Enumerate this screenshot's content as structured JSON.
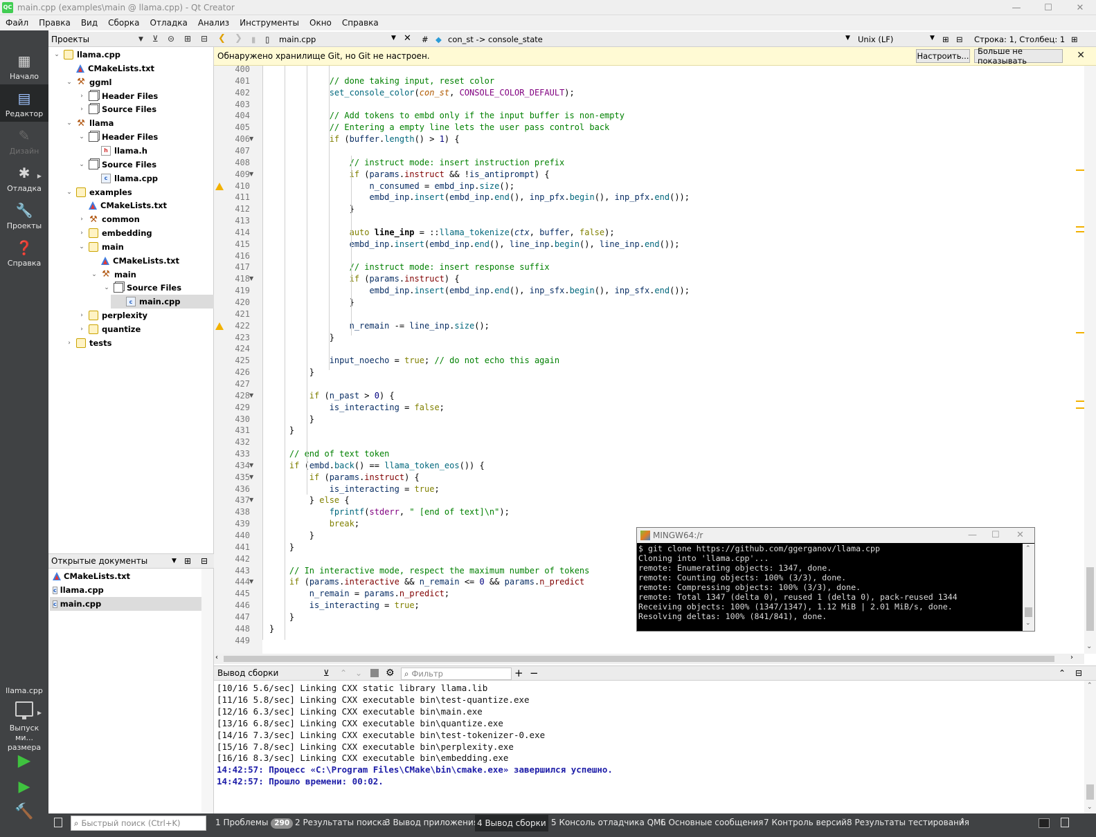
{
  "window": {
    "title": "main.cpp (examples\\main @ llama.cpp) - Qt Creator",
    "logo": "QC"
  },
  "menu": [
    "Файл",
    "Правка",
    "Вид",
    "Сборка",
    "Отладка",
    "Анализ",
    "Инструменты",
    "Окно",
    "Справка"
  ],
  "modes": [
    {
      "label": "Начало",
      "icon": "grid-icon"
    },
    {
      "label": "Редактор",
      "icon": "editor-icon"
    },
    {
      "label": "Дизайн",
      "icon": "design-icon"
    },
    {
      "label": "Отладка",
      "icon": "bug-icon"
    },
    {
      "label": "Проекты",
      "icon": "wrench-icon"
    },
    {
      "label": "Справка",
      "icon": "help-icon"
    }
  ],
  "kit": {
    "project": "llama.cpp",
    "config": "Выпуск ми... размера"
  },
  "projects_panel": {
    "title": "Проекты",
    "tree": [
      {
        "label": "llama.cpp",
        "depth": 0,
        "icon": "project",
        "expanded": true
      },
      {
        "label": "CMakeLists.txt",
        "depth": 1,
        "icon": "cmake"
      },
      {
        "label": "ggml",
        "depth": 1,
        "icon": "hammer",
        "expanded": true
      },
      {
        "label": "Header Files",
        "depth": 2,
        "icon": "folder",
        "expanded": false
      },
      {
        "label": "Source Files",
        "depth": 2,
        "icon": "folder",
        "expanded": false
      },
      {
        "label": "llama",
        "depth": 1,
        "icon": "hammer",
        "expanded": true
      },
      {
        "label": "Header Files",
        "depth": 2,
        "icon": "folder",
        "expanded": true
      },
      {
        "label": "llama.h",
        "depth": 3,
        "icon": "h"
      },
      {
        "label": "Source Files",
        "depth": 2,
        "icon": "folder",
        "expanded": true
      },
      {
        "label": "llama.cpp",
        "depth": 3,
        "icon": "cpp"
      },
      {
        "label": "examples",
        "depth": 1,
        "icon": "project",
        "expanded": true
      },
      {
        "label": "CMakeLists.txt",
        "depth": 2,
        "icon": "cmake"
      },
      {
        "label": "common",
        "depth": 2,
        "icon": "hammer",
        "expanded": false
      },
      {
        "label": "embedding",
        "depth": 2,
        "icon": "project",
        "expanded": false
      },
      {
        "label": "main",
        "depth": 2,
        "icon": "project",
        "expanded": true
      },
      {
        "label": "CMakeLists.txt",
        "depth": 3,
        "icon": "cmake"
      },
      {
        "label": "main",
        "depth": 3,
        "icon": "hammer",
        "expanded": true
      },
      {
        "label": "Source Files",
        "depth": 4,
        "icon": "folder",
        "expanded": true
      },
      {
        "label": "main.cpp",
        "depth": 5,
        "icon": "cpp",
        "selected": true
      },
      {
        "label": "perplexity",
        "depth": 2,
        "icon": "project",
        "expanded": false
      },
      {
        "label": "quantize",
        "depth": 2,
        "icon": "project",
        "expanded": false
      },
      {
        "label": "tests",
        "depth": 1,
        "icon": "project",
        "expanded": false
      }
    ]
  },
  "open_docs": {
    "title": "Открытые документы",
    "items": [
      {
        "label": "CMakeLists.txt",
        "icon": "cmake"
      },
      {
        "label": "llama.cpp",
        "icon": "cpp"
      },
      {
        "label": "main.cpp",
        "icon": "cpp",
        "selected": true
      }
    ]
  },
  "editor_toolbar": {
    "file": "main.cpp",
    "hash": "#",
    "symbol": "con_st -> console_state",
    "line_ending": "Unix (LF)",
    "position": "Строка: 1, Столбец: 1"
  },
  "git_bar": {
    "message": "Обнаружено хранилище Git, но Git не настроен.",
    "configure": "Настроить...",
    "dont_show": "Больше не показывать"
  },
  "code": {
    "lines": [
      {
        "n": "400",
        "html": ""
      },
      {
        "n": "401",
        "html": "            <span class='c-com'>// done taking input, reset color</span>"
      },
      {
        "n": "402",
        "html": "            <span class='c-fn'>set_console_color</span>(<span class='c-par'>con_st</span>, <span class='c-mac'>CONSOLE_COLOR_DEFAULT</span>);"
      },
      {
        "n": "403",
        "html": ""
      },
      {
        "n": "404",
        "html": "            <span class='c-com'>// Add tokens to embd only if the input buffer is non-empty</span>"
      },
      {
        "n": "405",
        "html": "            <span class='c-com'>// Entering a empty line lets the user pass control back</span>"
      },
      {
        "n": "406",
        "html": "            <span class='c-kw'>if</span> (<span class='c-var'>buffer</span>.<span class='c-fn'>length</span>() &gt; <span class='c-num'>1</span>) {",
        "fold": true
      },
      {
        "n": "407",
        "html": ""
      },
      {
        "n": "408",
        "html": "                <span class='c-com'>// instruct mode: insert instruction prefix</span>"
      },
      {
        "n": "409",
        "html": "                <span class='c-kw'>if</span> (<span class='c-var'>params</span>.<span class='c-mem'>instruct</span> &amp;&amp; !<span class='c-var'>is_antiprompt</span>) {",
        "fold": true
      },
      {
        "n": "410",
        "html": "                    <span class='c-var'>n_consumed</span> = <span class='c-var'>embd_inp</span>.<span class='c-fn'>size</span>();",
        "warn": true
      },
      {
        "n": "411",
        "html": "                    <span class='c-var'>embd_inp</span>.<span class='c-fn'>insert</span>(<span class='c-var'>embd_inp</span>.<span class='c-fn'>end</span>(), <span class='c-var'>inp_pfx</span>.<span class='c-fn'>begin</span>(), <span class='c-var'>inp_pfx</span>.<span class='c-fn'>end</span>());"
      },
      {
        "n": "412",
        "html": "                }"
      },
      {
        "n": "413",
        "html": ""
      },
      {
        "n": "414",
        "html": "                <span class='c-kw'>auto</span> <b>line_inp</b> = ::<span class='c-fn'>llama_tokenize</span>(<span class='c-var'><i>ctx</i></span>, <span class='c-var'>buffer</span>, <span class='c-kw'>false</span>);"
      },
      {
        "n": "415",
        "html": "                <span class='c-var'>embd_inp</span>.<span class='c-fn'>insert</span>(<span class='c-var'>embd_inp</span>.<span class='c-fn'>end</span>(), <span class='c-var'>line_inp</span>.<span class='c-fn'>begin</span>(), <span class='c-var'>line_inp</span>.<span class='c-fn'>end</span>());"
      },
      {
        "n": "416",
        "html": ""
      },
      {
        "n": "417",
        "html": "                <span class='c-com'>// instruct mode: insert response suffix</span>"
      },
      {
        "n": "418",
        "html": "                <span class='c-kw'>if</span> (<span class='c-var'>params</span>.<span class='c-mem'>instruct</span>) {",
        "fold": true
      },
      {
        "n": "419",
        "html": "                    <span class='c-var'>embd_inp</span>.<span class='c-fn'>insert</span>(<span class='c-var'>embd_inp</span>.<span class='c-fn'>end</span>(), <span class='c-var'>inp_sfx</span>.<span class='c-fn'>begin</span>(), <span class='c-var'>inp_sfx</span>.<span class='c-fn'>end</span>());"
      },
      {
        "n": "420",
        "html": "                }"
      },
      {
        "n": "421",
        "html": ""
      },
      {
        "n": "422",
        "html": "                <span class='c-var'>n_remain</span> -= <span class='c-var'>line_inp</span>.<span class='c-fn'>size</span>();",
        "warn": true
      },
      {
        "n": "423",
        "html": "            }"
      },
      {
        "n": "424",
        "html": ""
      },
      {
        "n": "425",
        "html": "            <span class='c-var'>input_noecho</span> = <span class='c-kw'>true</span>; <span class='c-com'>// do not echo this again</span>"
      },
      {
        "n": "426",
        "html": "        }"
      },
      {
        "n": "427",
        "html": ""
      },
      {
        "n": "428",
        "html": "        <span class='c-kw'>if</span> (<span class='c-var'>n_past</span> &gt; <span class='c-num'>0</span>) {",
        "fold": true
      },
      {
        "n": "429",
        "html": "            <span class='c-var'>is_interacting</span> = <span class='c-kw'>false</span>;"
      },
      {
        "n": "430",
        "html": "        }"
      },
      {
        "n": "431",
        "html": "    }"
      },
      {
        "n": "432",
        "html": ""
      },
      {
        "n": "433",
        "html": "    <span class='c-com'>// end of text token</span>"
      },
      {
        "n": "434",
        "html": "    <span class='c-kw'>if</span> (<span class='c-var'>embd</span>.<span class='c-fn'>back</span>() == <span class='c-fn'>llama_token_eos</span>()) {",
        "fold": true
      },
      {
        "n": "435",
        "html": "        <span class='c-kw'>if</span> (<span class='c-var'>params</span>.<span class='c-mem'>instruct</span>) {",
        "fold": true
      },
      {
        "n": "436",
        "html": "            <span class='c-var'>is_interacting</span> = <span class='c-kw'>true</span>;"
      },
      {
        "n": "437",
        "html": "        } <span class='c-kw'>else</span> {",
        "fold": true
      },
      {
        "n": "438",
        "html": "            <span class='c-fn'>fprintf</span>(<span class='c-mac'>stderr</span>, <span class='c-str'>\" [end of text]\\n\"</span>);"
      },
      {
        "n": "439",
        "html": "            <span class='c-kw'>break</span>;"
      },
      {
        "n": "440",
        "html": "        }"
      },
      {
        "n": "441",
        "html": "    }"
      },
      {
        "n": "442",
        "html": ""
      },
      {
        "n": "443",
        "html": "    <span class='c-com'>// In interactive mode, respect the maximum number of tokens</span>"
      },
      {
        "n": "444",
        "html": "    <span class='c-kw'>if</span> (<span class='c-var'>params</span>.<span class='c-mem'>interactive</span> &amp;&amp; <span class='c-var'>n_remain</span> &lt;= <span class='c-num'>0</span> &amp;&amp; <span class='c-var'>params</span>.<span class='c-mem'>n_predict</span>",
        "fold": true
      },
      {
        "n": "445",
        "html": "        <span class='c-var'>n_remain</span> = <span class='c-var'>params</span>.<span class='c-mem'>n_predict</span>;"
      },
      {
        "n": "446",
        "html": "        <span class='c-var'>is_interacting</span> = <span class='c-kw'>true</span>;"
      },
      {
        "n": "447",
        "html": "    }"
      },
      {
        "n": "448",
        "html": "}"
      },
      {
        "n": "449",
        "html": ""
      }
    ]
  },
  "terminal": {
    "title": "MINGW64:/r",
    "lines": [
      "$ git clone https://github.com/ggerganov/llama.cpp",
      "Cloning into 'llama.cpp'...",
      "remote: Enumerating objects: 1347, done.",
      "remote: Counting objects: 100% (3/3), done.",
      "remote: Compressing objects: 100% (3/3), done.",
      "remote: Total 1347 (delta 0), reused 1 (delta 0), pack-reused 1344",
      "Receiving objects: 100% (1347/1347), 1.12 MiB | 2.01 MiB/s, done.",
      "Resolving deltas: 100% (841/841), done."
    ]
  },
  "build_output": {
    "title": "Вывод сборки",
    "filter_placeholder": "Фильтр",
    "lines": [
      {
        "text": "[10/16 5.6/sec] Linking CXX static library llama.lib"
      },
      {
        "text": "[11/16 5.8/sec] Linking CXX executable bin\\test-quantize.exe"
      },
      {
        "text": "[12/16 6.3/sec] Linking CXX executable bin\\main.exe"
      },
      {
        "text": "[13/16 6.8/sec] Linking CXX executable bin\\quantize.exe"
      },
      {
        "text": "[14/16 7.3/sec] Linking CXX executable bin\\test-tokenizer-0.exe"
      },
      {
        "text": "[15/16 7.8/sec] Linking CXX executable bin\\perplexity.exe"
      },
      {
        "text": "[16/16 8.3/sec] Linking CXX executable bin\\embedding.exe"
      },
      {
        "text": "14:42:57: Процесс «C:\\Program Files\\CMake\\bin\\cmake.exe» завершился успешно.",
        "ok": true
      },
      {
        "text": "14:42:57: Прошло времени: 00:02.",
        "ok": true
      }
    ]
  },
  "status_bar": {
    "search_placeholder": "Быстрый поиск (Ctrl+K)",
    "tabs": [
      {
        "label": "1  Проблемы",
        "badge": "290"
      },
      {
        "label": "2  Результаты поиска"
      },
      {
        "label": "3  Вывод приложения"
      },
      {
        "label": "4  Вывод сборки",
        "active": true
      },
      {
        "label": "5  Консоль отладчика QML"
      },
      {
        "label": "6  Основные сообщения"
      },
      {
        "label": "7  Контроль версий"
      },
      {
        "label": "8  Результаты тестирования"
      }
    ]
  }
}
